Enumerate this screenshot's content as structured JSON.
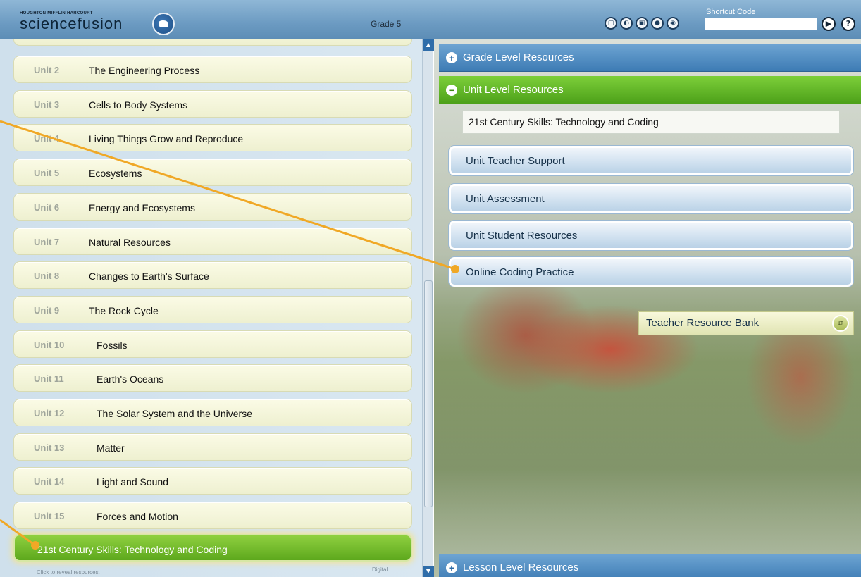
{
  "header": {
    "publisher": "HOUGHTON MIFFLIN HARCOURT",
    "product": "sciencefusion",
    "grade": "Grade 5",
    "shortcut_label": "Shortcut Code",
    "shortcut_value": "",
    "tool_icons": [
      "planner-icon",
      "reader-icon",
      "media-icon",
      "people-icon",
      "settings-icon"
    ]
  },
  "units": [
    {
      "num": "Unit 2",
      "title": "The Engineering Process"
    },
    {
      "num": "Unit 3",
      "title": "Cells to Body Systems"
    },
    {
      "num": "Unit 4",
      "title": "Living Things Grow and Reproduce"
    },
    {
      "num": "Unit 5",
      "title": "Ecosystems"
    },
    {
      "num": "Unit 6",
      "title": "Energy and Ecosystems"
    },
    {
      "num": "Unit 7",
      "title": "Natural Resources"
    },
    {
      "num": "Unit 8",
      "title": "Changes to Earth's Surface"
    },
    {
      "num": "Unit 9",
      "title": "The Rock Cycle"
    },
    {
      "num": "Unit 10",
      "title": "Fossils"
    },
    {
      "num": "Unit 11",
      "title": "Earth's Oceans"
    },
    {
      "num": "Unit 12",
      "title": "The Solar System and the Universe"
    },
    {
      "num": "Unit 13",
      "title": "Matter"
    },
    {
      "num": "Unit 14",
      "title": "Light and Sound"
    },
    {
      "num": "Unit 15",
      "title": "Forces and Motion"
    }
  ],
  "selected_unit": "21st Century Skills: Technology and Coding",
  "left_footer": "Click to reveal resources.",
  "left_footer_right": "Digital",
  "resources": {
    "grade_level": "Grade Level Resources",
    "unit_level": "Unit Level Resources",
    "unit_title": "21st Century Skills: Technology and Coding",
    "buttons": [
      "Unit Teacher Support",
      "Unit Assessment",
      "Unit Student Resources",
      "Online Coding Practice"
    ],
    "bank": "Teacher Resource Bank",
    "lesson_level": "Lesson Level Resources"
  }
}
